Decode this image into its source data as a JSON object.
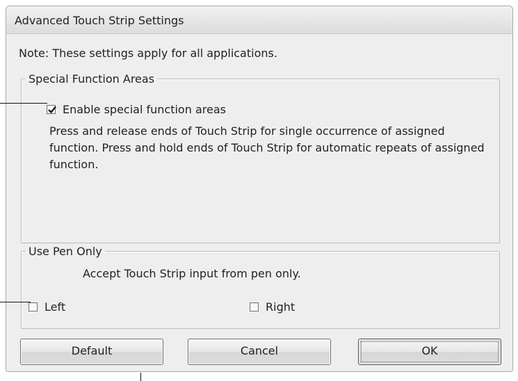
{
  "window": {
    "title": "Advanced Touch Strip Settings"
  },
  "note": "Note: These settings apply for all applications.",
  "special_function_areas": {
    "legend": "Special Function Areas",
    "checkbox_label": "Enable special function areas",
    "checked": true,
    "description": "Press and release ends of Touch Strip for single occurrence of assigned function. Press and hold ends of Touch Strip for automatic repeats of assigned function."
  },
  "use_pen_only": {
    "legend": "Use Pen Only",
    "description": "Accept Touch Strip input from pen only.",
    "left_label": "Left",
    "left_checked": false,
    "right_label": "Right",
    "right_checked": false
  },
  "buttons": {
    "default_label": "Default",
    "cancel_label": "Cancel",
    "ok_label": "OK"
  },
  "icons": {
    "checkmark": "checkmark-icon"
  },
  "colors": {
    "dialog_background": "#eeeeee",
    "text": "#222222",
    "group_border": "#b9b9b9"
  }
}
